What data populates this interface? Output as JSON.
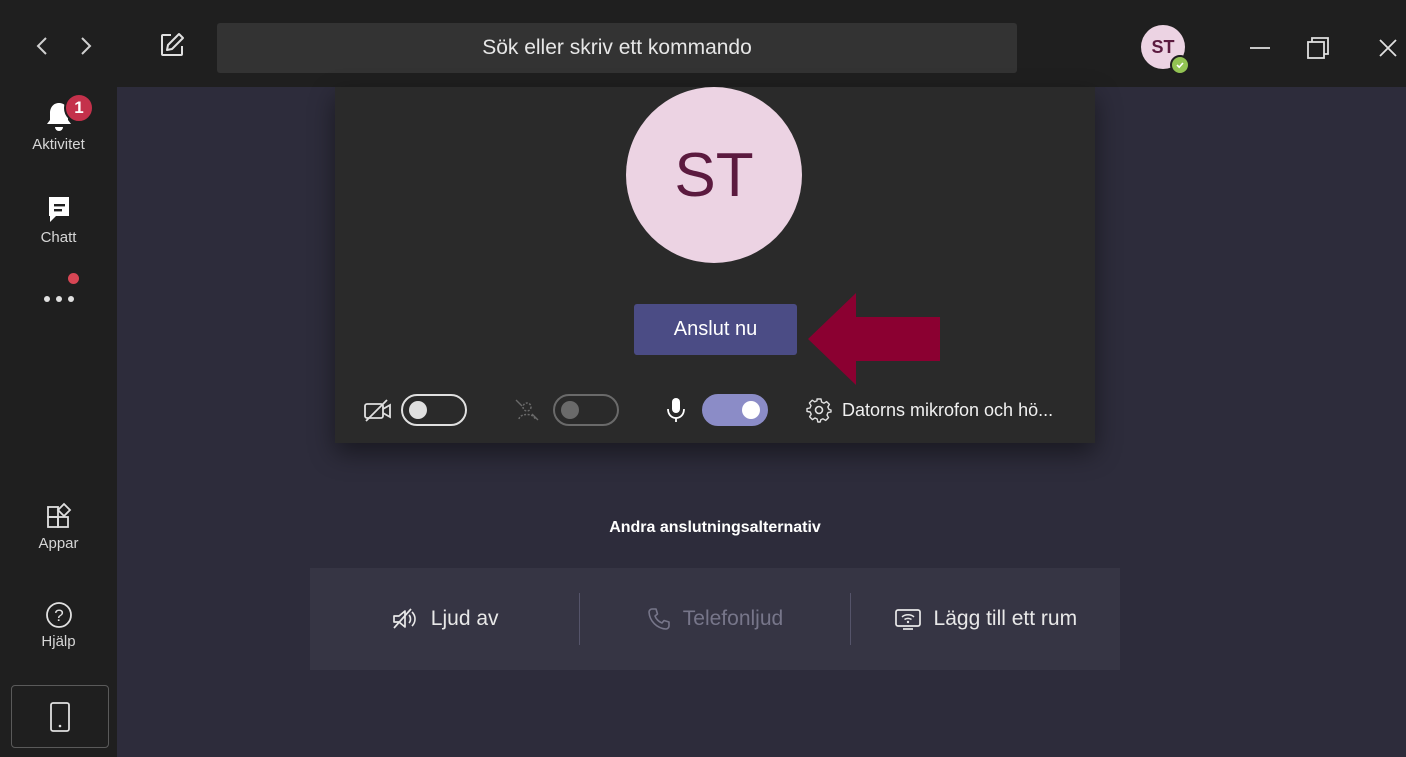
{
  "topbar": {
    "search_placeholder": "Sök eller skriv ett kommando",
    "user_initials": "ST"
  },
  "rail": {
    "items": [
      {
        "label": "Aktivitet",
        "icon": "bell-icon",
        "badge": "1"
      },
      {
        "label": "Chatt",
        "icon": "chat-icon"
      },
      {
        "label": "Appar",
        "icon": "apps-icon"
      },
      {
        "label": "Hjälp",
        "icon": "help-icon"
      }
    ]
  },
  "prejoin": {
    "avatar_initials": "ST",
    "join_label": "Anslut nu",
    "camera_on": false,
    "background_blur_on": false,
    "mic_on": true,
    "device_label": "Datorns mikrofon och hö..."
  },
  "other_options": {
    "title": "Andra anslutningsalternativ",
    "items": [
      {
        "label": "Ljud av",
        "icon": "speaker-off-icon",
        "enabled": true
      },
      {
        "label": "Telefonljud",
        "icon": "phone-icon",
        "enabled": false
      },
      {
        "label": "Lägg till ett rum",
        "icon": "room-icon",
        "enabled": true
      }
    ]
  },
  "colors": {
    "accent": "#4b4c85",
    "toggle_on": "#8b8cc7",
    "arrow": "#8b0031",
    "badge": "#c4314b",
    "presence": "#92c353"
  }
}
